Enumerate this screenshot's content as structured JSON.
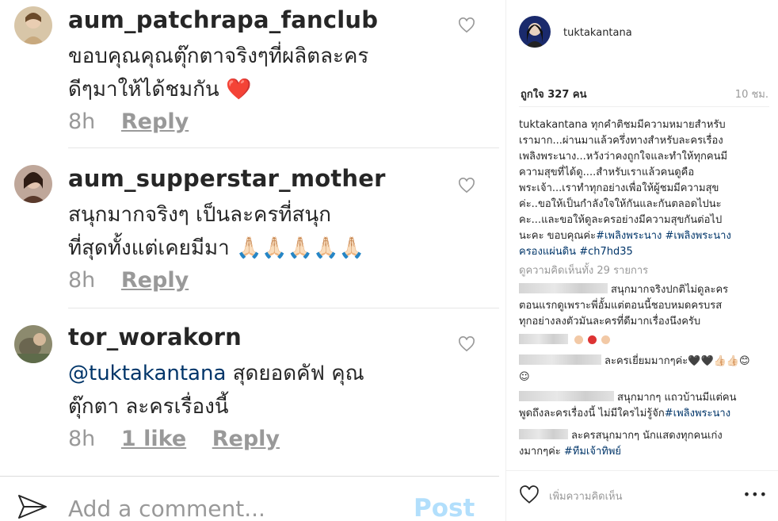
{
  "comments": [
    {
      "username": "aum_patchrapa_fanclub",
      "text_line1": "ขอบคุณคุณตุ๊กตาจริงๆที่ผลิตละคร",
      "text_line2": "ดีๆมาให้ได้ชมกัน ❤️",
      "time": "8h",
      "reply": "Reply"
    },
    {
      "username": "aum_supperstar_mother",
      "text_line1": "สนุกมากจริงๆ เป็นละครที่สนุก",
      "text_line2": "ที่สุดทั้งแต่เคยมีมา 🙏🏻🙏🏻🙏🏻🙏🏻🙏🏻",
      "time": "8h",
      "reply": "Reply"
    },
    {
      "username": "tor_worakorn",
      "mention": "@tuktakantana",
      "text_line1_rest": " สุดยอดคัฟ คุณ",
      "text_line2": "ตุ๊กตา ละครเรื่องนี้",
      "time": "8h",
      "likes": "1 like",
      "reply": "Reply"
    }
  ],
  "add_comment": {
    "placeholder": "Add a comment...",
    "post_label": "Post"
  },
  "panel": {
    "username": "tuktakantana",
    "likes": "ถูกใจ 327 คน",
    "time": "10 ชม.",
    "caption_user": "tuktakantana",
    "caption_lines": [
      " ทุกคำติชมมีความหมายสำหรับ",
      "เรามาก...ผ่านมาแล้วครึ่งทางสำหรับละครเรื่อง",
      "เพลิงพระนาง...หวังว่าคงถูกใจและทำให้ทุกคนมี",
      "ความสุขที่ได้ดู....สำหรับเราแล้วคนดูคือ",
      "พระเจ้า...เราทำทุกอย่างเพื่อให้ผู้ชมมีความสุข",
      "ค่ะ..ขอให้เป็นกำลังใจให้กันและกันตลอดไปนะ",
      "คะ...และขอให้ดูละครอย่างมีความสุขกันต่อไป",
      "นะคะ ขอบคุณค่ะ"
    ],
    "caption_tags": [
      "#เพลิงพระนาง",
      "#เพลิงพระนาง",
      "ครองแผ่นดิน",
      "#ch7hd35"
    ],
    "view_all": "ดูความคิดเห็นทั้ง 29 รายการ",
    "comments": [
      {
        "line1": "สนุกมากจริงปกติไม่ดูละคร",
        "line2": "ตอนแรกดูเพราะพี่อั้มแต่ตอนนี้ชอบหมดครบรส",
        "line3": "ทุกอย่างลงตัวมันละครที่ดีมากเรื่องนึงครับ"
      },
      {
        "line1": ""
      },
      {
        "line1": "ละครเยี่ยมมากๆค่ะ🖤🖤👍🏻👍🏻😊",
        "line2": "☺"
      },
      {
        "line1": "สนุกมากๆ แถวบ้านมีแต่คน",
        "line2": "พูดถึงละครเรื่องนี้ ไม่มีใครไม่รู้จัก",
        "tag2": "#เพลิงพระนาง"
      },
      {
        "line1": "ละครสนุกมากๆ นักแสดงทุกคนเก่ง",
        "line2": "งมากๆค่ะ ",
        "tag2": "#ทีมเจ้าทิพย์"
      }
    ],
    "add_placeholder": "เพิ่มความคิดเห็น",
    "more_label": "•••"
  },
  "colors": {
    "text": "#262626",
    "muted": "#999999",
    "link": "#003569",
    "post_disabled": "#b2dffc",
    "heart_red": "#e0245e"
  },
  "icons": [
    "heart-outline-icon",
    "send-icon",
    "heart-icon",
    "more-icon"
  ]
}
